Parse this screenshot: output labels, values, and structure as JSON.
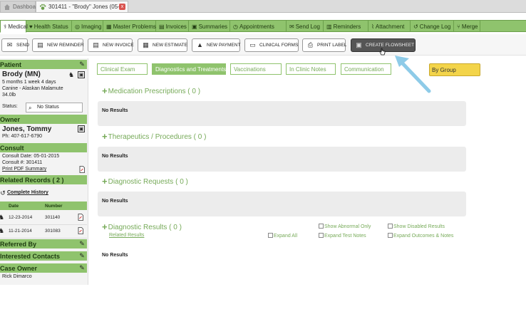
{
  "tabs": [
    {
      "label": "Dashboard"
    },
    {
      "label": "301411 - \"Brody\" Jones (05-...",
      "close": "x"
    }
  ],
  "module_nav": [
    {
      "label": "Medical",
      "icon": "stethoscope-icon",
      "glyph": "⚕"
    },
    {
      "label": "Health Status",
      "icon": "heart-icon",
      "glyph": "♥"
    },
    {
      "label": "Imaging",
      "icon": "camera-icon",
      "glyph": "◎"
    },
    {
      "label": "Master Problems",
      "icon": "grid-icon",
      "glyph": "▦"
    },
    {
      "label": "Invoices",
      "icon": "invoice-icon",
      "glyph": "▤"
    },
    {
      "label": "Summaries",
      "icon": "book-icon",
      "glyph": "▣"
    },
    {
      "label": "Appointments",
      "icon": "clock-icon",
      "glyph": "◷"
    },
    {
      "label": "Send Log",
      "icon": "envelope-icon",
      "glyph": "✉"
    },
    {
      "label": "Reminders",
      "icon": "list-icon",
      "glyph": "▥"
    },
    {
      "label": "Attachment",
      "icon": "paperclip-icon",
      "glyph": "⌇"
    },
    {
      "label": "Change Log",
      "icon": "history-icon",
      "glyph": "↺"
    },
    {
      "label": "Merge",
      "icon": "merge-icon",
      "glyph": "⑂"
    }
  ],
  "toolbar": [
    {
      "label": "SEND",
      "glyph": "✉"
    },
    {
      "label": "NEW REMINDER",
      "glyph": "▤"
    },
    {
      "label": "NEW INVOICE",
      "glyph": "▤"
    },
    {
      "label": "NEW ESTIMATE",
      "glyph": "▦"
    },
    {
      "label": "NEW PAYMENT",
      "glyph": "▲"
    },
    {
      "label": "CLINICAL FORMS",
      "glyph": "▭"
    },
    {
      "label": "PRINT LABEL",
      "glyph": "⎙"
    },
    {
      "label": "CREATE FLOWSHEET",
      "glyph": "▣"
    }
  ],
  "sidebar": {
    "patient_header": "Patient",
    "patient_name": "Brody (MN)",
    "patient_age": "5 months 1 week 4 days",
    "patient_breed": "Canine - Alaskan Malamute",
    "patient_weight": "34.0lb",
    "status_label": "Status:",
    "status_value": "No Status",
    "owner_header": "Owner",
    "owner_name": "Jones, Tommy",
    "owner_phone": "Ph: 407-617-6790",
    "consult_header": "Consult",
    "consult_date": "Consult Date: 05-01-2015",
    "consult_number": "Consult #: 301411",
    "consult_print": "Print PDF Summary",
    "related_header": "Related Records ( 2 )",
    "complete_history": "Complete History",
    "table_headers": {
      "date": "Date",
      "number": "Number"
    },
    "records": [
      {
        "date": "12-23-2014",
        "number": "301140"
      },
      {
        "date": "11-21-2014",
        "number": "301083"
      }
    ],
    "referred_header": "Referred By",
    "contacts_header": "Interested Contacts",
    "case_owner_header": "Case Owner",
    "case_owner_name": "Rick Dimarco"
  },
  "filters": [
    {
      "label": "Clinical Exam",
      "active": false
    },
    {
      "label": "Diagnostics and Treatments",
      "active": true
    },
    {
      "label": "Vaccinations",
      "active": false
    },
    {
      "label": "In Clinic Notes",
      "active": false
    },
    {
      "label": "Communication",
      "active": false
    }
  ],
  "group_select": "By Group",
  "sections": [
    {
      "title": "Medication Prescriptions ( 0 )",
      "empty": "No Results"
    },
    {
      "title": "Therapeutics / Procedures ( 0 )",
      "empty": "No Results"
    },
    {
      "title": "Diagnostic Requests ( 0 )",
      "empty": "No Results"
    },
    {
      "title": "Diagnostic Results ( 0 )",
      "empty": "No Results"
    }
  ],
  "diag_results": {
    "related_link": "Related Results",
    "options": [
      {
        "label": "Show Abnormal Only"
      },
      {
        "label": "Show Disabled Results"
      },
      {
        "label": "Expand All"
      },
      {
        "label": "Expand Test Notes"
      },
      {
        "label": "Expand Outcomes & Notes"
      }
    ]
  },
  "colors": {
    "accent_green": "#8fc36d",
    "text_green": "#76aa58",
    "group_yellow": "#f3d44a",
    "arrow_blue": "#8ecbe8"
  }
}
